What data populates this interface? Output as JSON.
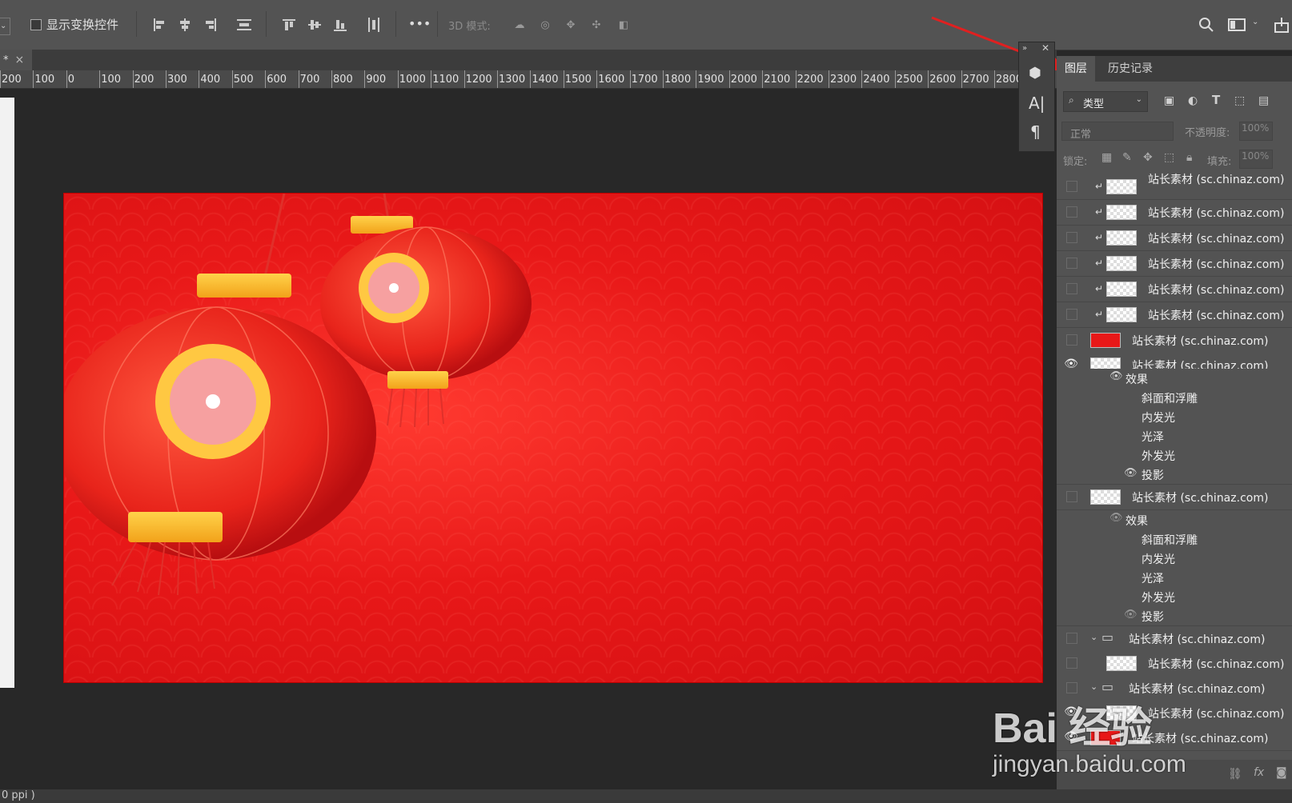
{
  "options_bar": {
    "show_transform_label": "显示变换控件",
    "mode_3d_label": "3D 模式:",
    "more_label": "•••"
  },
  "doc_tab": {
    "title": "*",
    "close": "×"
  },
  "ruler": {
    "ticks": [
      "200",
      "100",
      "0",
      "100",
      "200",
      "300",
      "400",
      "500",
      "600",
      "700",
      "800",
      "900",
      "1000",
      "1100",
      "1200",
      "1300",
      "1400",
      "1500",
      "1600",
      "1700",
      "1800",
      "1900",
      "2000",
      "2100",
      "2200",
      "2300",
      "2400",
      "2500",
      "2600",
      "2700",
      "2800"
    ]
  },
  "panel": {
    "tab_layers": "图层",
    "tab_history": "历史记录",
    "filter_label": "类型",
    "blend_mode": "正常",
    "opacity_label": "不透明度:",
    "opacity_value": "100%",
    "lock_label": "锁定:",
    "fill_label": "填充:",
    "fill_value": "100%"
  },
  "layers": [
    {
      "name": "站长素材 (sc.chinaz.com)",
      "clipped": true,
      "visible": false
    },
    {
      "name": "站长素材 (sc.chinaz.com)",
      "clipped": true,
      "visible": false
    },
    {
      "name": "站长素材 (sc.chinaz.com)",
      "clipped": true,
      "visible": false
    },
    {
      "name": "站长素材 (sc.chinaz.com)",
      "clipped": true,
      "visible": false
    },
    {
      "name": "站长素材 (sc.chinaz.com)",
      "clipped": true,
      "visible": false
    },
    {
      "name": "站长素材 (sc.chinaz.com)",
      "clipped": true,
      "visible": false
    },
    {
      "name": "站长素材 (sc.chinaz.com)",
      "clipped": false,
      "visible": false
    },
    {
      "name": "站长素材 (sc.chinaz.com)",
      "clipped": false,
      "visible": true
    }
  ],
  "effects_a": {
    "title": "效果",
    "items": [
      "斜面和浮雕",
      "内发光",
      "光泽",
      "外发光",
      "投影"
    ]
  },
  "layer_b": {
    "name": "站长素材 (sc.chinaz.com)"
  },
  "effects_b": {
    "title": "效果",
    "items": [
      "斜面和浮雕",
      "内发光",
      "光泽",
      "外发光",
      "投影"
    ]
  },
  "group_a": {
    "name": "站长素材 (sc.chinaz.com)"
  },
  "layer_c": {
    "name": "站长素材 (sc.chinaz.com)"
  },
  "group_b": {
    "name": "站长素材 (sc.chinaz.com)"
  },
  "layer_d": {
    "name": "站长素材 (sc.chinaz.com)"
  },
  "layer_e": {
    "name": "站长素材 (sc.chinaz.com)"
  },
  "watermark": {
    "brand": "Bai 经验",
    "url": "jingyan.baidu.com"
  },
  "status": {
    "text": "0 ppi )"
  },
  "colors": {
    "accent_arrow": "#e02020",
    "artwork_red": "#e81818"
  }
}
